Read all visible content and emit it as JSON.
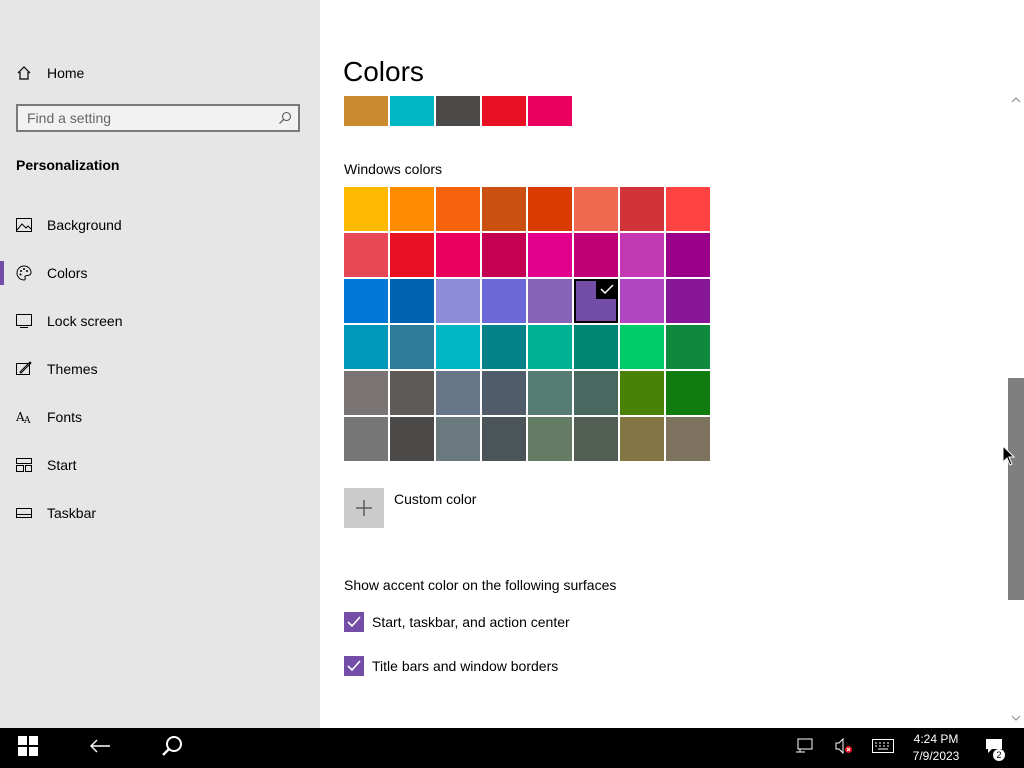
{
  "sidebar": {
    "home_label": "Home",
    "search_placeholder": "Find a setting",
    "section_title": "Personalization",
    "items": [
      {
        "label": "Background",
        "icon": "image-icon"
      },
      {
        "label": "Colors",
        "icon": "palette-icon",
        "active": true
      },
      {
        "label": "Lock screen",
        "icon": "lock-screen-icon"
      },
      {
        "label": "Themes",
        "icon": "themes-icon"
      },
      {
        "label": "Fonts",
        "icon": "fonts-icon"
      },
      {
        "label": "Start",
        "icon": "start-icon"
      },
      {
        "label": "Taskbar",
        "icon": "taskbar-icon"
      }
    ]
  },
  "main": {
    "title": "Colors",
    "recent_colors": [
      "#ca8a2e",
      "#00b7c3",
      "#4c4a48",
      "#e81123",
      "#ea005e"
    ],
    "windows_colors_label": "Windows colors",
    "windows_colors": [
      [
        "#ffb900",
        "#ff8c00",
        "#f7630c",
        "#ca5010",
        "#da3b01",
        "#ef6950",
        "#d13438",
        "#ff4343"
      ],
      [
        "#e74856",
        "#e81123",
        "#ea005e",
        "#c30052",
        "#e3008c",
        "#bf0077",
        "#c239b3",
        "#9a0089"
      ],
      [
        "#0078d7",
        "#0063b1",
        "#8e8cd8",
        "#6b69d6",
        "#8764b8",
        "#744da9",
        "#b146c2",
        "#881798"
      ],
      [
        "#0099bc",
        "#2d7d9a",
        "#00b7c3",
        "#038387",
        "#00b294",
        "#018574",
        "#00cc6a",
        "#10893e"
      ],
      [
        "#7a7574",
        "#5d5a58",
        "#68768a",
        "#515c6b",
        "#567c73",
        "#486860",
        "#498205",
        "#107c10"
      ],
      [
        "#767676",
        "#4c4a48",
        "#69797e",
        "#4a5459",
        "#647c64",
        "#525e54",
        "#847545",
        "#7e735f"
      ]
    ],
    "selected_color": "#744da9",
    "custom_color_label": "Custom color",
    "surfaces_label": "Show accent color on the following surfaces",
    "options": [
      {
        "label": "Start, taskbar, and action center",
        "checked": true
      },
      {
        "label": "Title bars and window borders",
        "checked": true
      }
    ],
    "accent_color": "#744da9"
  },
  "taskbar": {
    "time": "4:24 PM",
    "date": "7/9/2023",
    "notification_count": "2"
  }
}
